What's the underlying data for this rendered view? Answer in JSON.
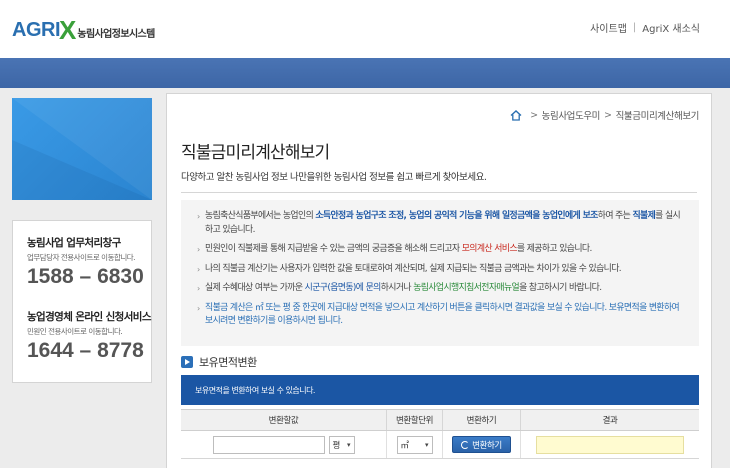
{
  "header": {
    "logo_text": "AGRI",
    "logo_x": "X",
    "logo_sub": "농림사업정보시스템",
    "links": [
      "사이트맵",
      "AgriX 새소식"
    ],
    "link_sep": "|"
  },
  "colors": {
    "brand_blue": "#2a6fb0",
    "brand_green": "#3aa03a",
    "band": "#4a74b4",
    "notice": "#1b56a4",
    "result_bg": "#fffbd0"
  },
  "sidebar": {
    "contacts": [
      {
        "title": "농림사업 업무처리창구",
        "sub": "업무담당자 전용사이트로 이동합니다.",
        "phone": "1588 – 6830"
      },
      {
        "title": "농업경영체 온라인 신청서비스",
        "sub": "민원인 전용사이트로 이동합니다.",
        "phone": "1644 – 8778"
      }
    ]
  },
  "breadcrumb": {
    "icon": "home-icon",
    "items": [
      "농림사업도우미",
      "직불금미리계산해보기"
    ],
    "arrow": ">"
  },
  "main": {
    "title": "직불금미리계산해보기",
    "description": "다양하고 알찬 농림사업 정보 나만을위한 농림사업 정보를 쉽고 빠르게 찾아보세요.",
    "info": {
      "r1_a": "농림축산식품부에서는 농업인의 ",
      "r1_b": "소득안정과 농업구조 조정, 농업의 공익적 기능을 위해 일정금액을 농업인에게 보조",
      "r1_c": "하여 주는 ",
      "r1_d": "직불제",
      "r1_e": "를 실시하고 있습니다.",
      "r2_a": "민원인이 직불제를 통해 지급받을 수 있는 금액의 궁금증을 해소해 드리고자 ",
      "r2_b": "모의계산 서비스",
      "r2_c": "를 제공하고 있습니다.",
      "r3": "나의 직불금 계산기는 사용자가 입력한 값을 토대로하여 계산되며, 실제 지급되는 직불금 금액과는 차이가 있을 수 있습니다.",
      "r4_a": "실제 수혜대상 여부는 가까운 ",
      "r4_b": "시군구(읍면동)에 문의",
      "r4_c": "하시거나 ",
      "r4_d": "농림사업시행지침서전자매뉴얼",
      "r4_e": "을 참고하시기 바랍니다.",
      "r5": "직불금 계산은 ㎡ 또는 평 중 한곳에 지급대상 면적을 넣으시고 계산하기 버튼을 클릭하시면 결과값을 보실 수 있습니다. 보유면적을 변환하여 보시려면 변환하기를 이용하시면 됩니다."
    },
    "section_label": "보유면적변환",
    "notice": "보유면적을 변환하여 보실 수 있습니다.",
    "table": {
      "headers": [
        "변환할값",
        "변환할단위",
        "변환하기",
        "결과"
      ],
      "input_value": "",
      "unit1_selected": "평",
      "unit2_selected": "㎡",
      "convert_button": "변환하기",
      "result_value": ""
    }
  }
}
